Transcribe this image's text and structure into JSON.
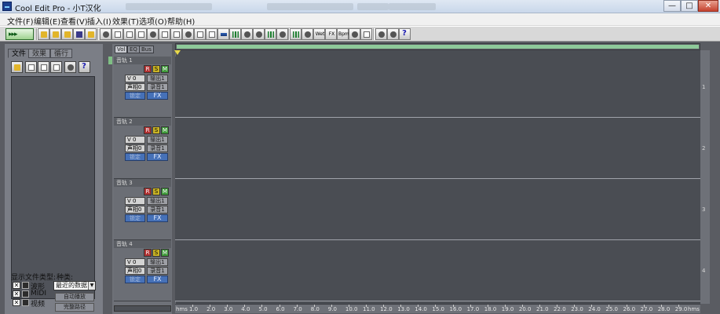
{
  "window": {
    "title": "Cool Edit Pro  - 小T汉化",
    "controls": {
      "minimize": "—",
      "maximize": "□",
      "close": "✕"
    }
  },
  "menu": [
    "文件(F)",
    "编辑(E)",
    "查看(V)",
    "插入(I)",
    "效果(T)",
    "选项(O)",
    "帮助(H)"
  ],
  "toolbar": {
    "multitrack_label": "▸▸▸",
    "text_buttons": [
      "Wet",
      "FX",
      "Bpm"
    ],
    "help": "?"
  },
  "organizer": {
    "tabs": [
      "文件",
      "效果",
      "循行"
    ],
    "help": "?",
    "show_types_label": "显示文件类型:",
    "sort_label": "种类:",
    "file_types": [
      {
        "checked": "✕",
        "label": "波形"
      },
      {
        "checked": "✕",
        "label": "MIDI"
      },
      {
        "checked": "✕",
        "label": "视频"
      }
    ],
    "sort_value": "最近的数据",
    "sort_arrow": "▼",
    "auto_play_button": "自动播放",
    "full_path_button": "完整路径"
  },
  "track_panel": {
    "tabs": [
      "Vol",
      "EQ",
      "Bus"
    ],
    "rsm": [
      "R",
      "S",
      "M"
    ],
    "tracks": [
      {
        "name": "音轨 1",
        "volume": "V 0",
        "pan": "声相0",
        "output": "输出1",
        "record": "录音1",
        "lock": "锁定",
        "fx": "FX",
        "number": "1"
      },
      {
        "name": "音轨 2",
        "volume": "V 0",
        "pan": "声相0",
        "output": "输出1",
        "record": "录音1",
        "lock": "锁定",
        "fx": "FX",
        "number": "2"
      },
      {
        "name": "音轨 3",
        "volume": "V 0",
        "pan": "声相0",
        "output": "输出1",
        "record": "录音1",
        "lock": "锁定",
        "fx": "FX",
        "number": "3"
      },
      {
        "name": "音轨 4",
        "volume": "V 0",
        "pan": "声相0",
        "output": "输出1",
        "record": "录音1",
        "lock": "锁定",
        "fx": "FX",
        "number": "4"
      }
    ]
  },
  "ruler": {
    "unit_start": "hms",
    "unit_end": "hms",
    "labels": [
      "1.0",
      "2.0",
      "3.0",
      "4.0",
      "5.0",
      "6.0",
      "7.0",
      "8.0",
      "9.0",
      "10.0",
      "11.0",
      "12.0",
      "13.0",
      "14.0",
      "15.0",
      "16.0",
      "17.0",
      "18.0",
      "19.0",
      "20.0",
      "21.0",
      "22.0",
      "23.0",
      "24.0",
      "25.0",
      "26.0",
      "27.0",
      "28.0",
      "29.0"
    ]
  }
}
